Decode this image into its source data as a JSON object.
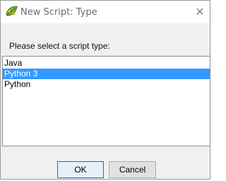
{
  "window": {
    "title": "New Script: Type",
    "close_glyph": "✕",
    "icon": "script-leaf-icon"
  },
  "prompt": "Please select a script type:",
  "script_types": {
    "items": [
      "Java",
      "Python 3",
      "Python"
    ],
    "selected": "Python 3"
  },
  "buttons": {
    "ok_label": "OK",
    "cancel_label": "Cancel"
  },
  "colors": {
    "selection": "#3399ff",
    "dialog_bg": "#f0f0f0",
    "title_text": "#6b6b6b"
  }
}
